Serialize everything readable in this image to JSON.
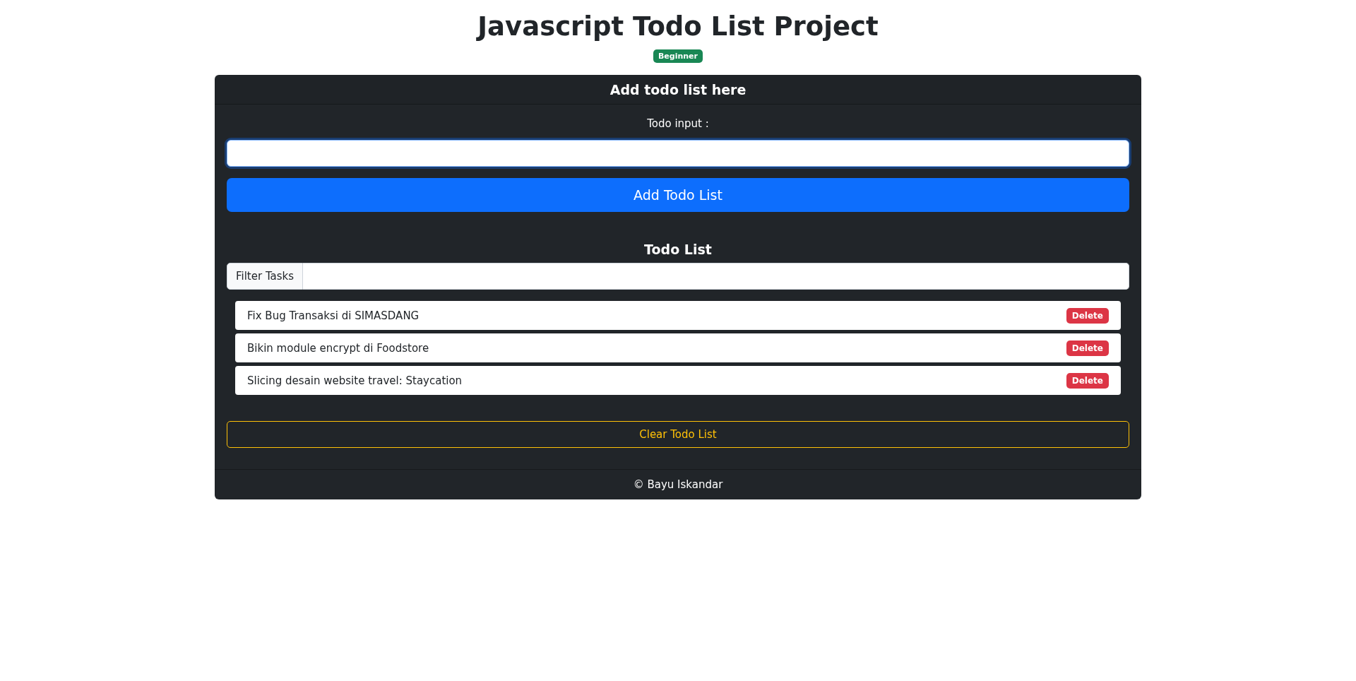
{
  "page": {
    "title": "Javascript Todo List Project",
    "badge": "Beginner"
  },
  "card": {
    "header": "Add todo list here",
    "input": {
      "label": "Todo input :",
      "focused": true
    },
    "add_button": "Add Todo List",
    "list_title": "Todo List",
    "filter": {
      "label": "Filter Tasks"
    },
    "todos": [
      {
        "text": "Fix Bug Transaksi di SIMASDANG",
        "action": "Delete"
      },
      {
        "text": "Bikin module encrypt di Foodstore",
        "action": "Delete"
      },
      {
        "text": "Slicing desain website travel: Staycation",
        "action": "Delete"
      }
    ],
    "clear_button": "Clear Todo List",
    "footer": "© Bayu Iskandar"
  }
}
